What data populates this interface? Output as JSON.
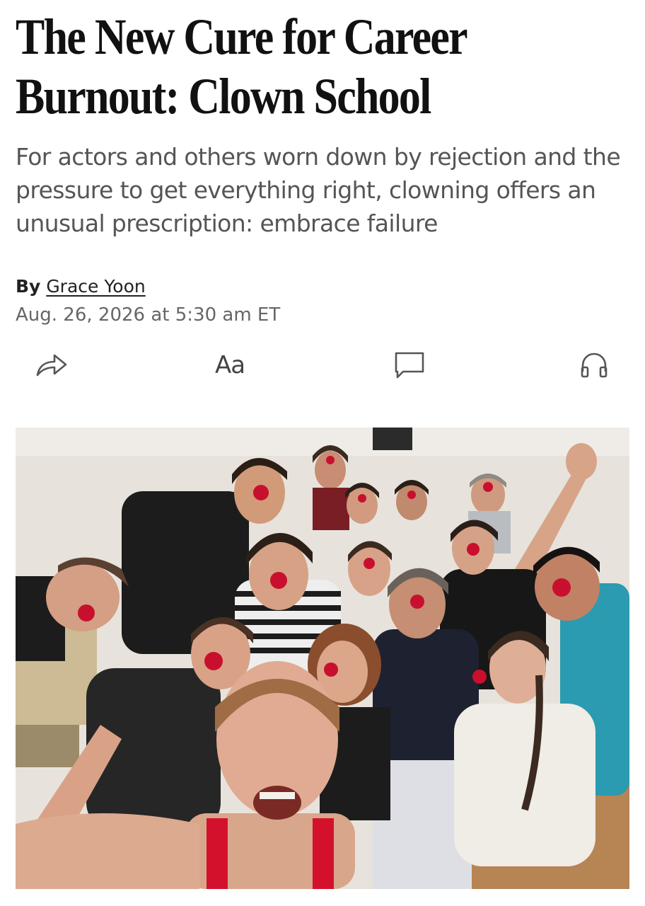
{
  "article": {
    "headline": "The New Cure for Career Burnout: Clown School",
    "dek": "For actors and others worn down by rejection and the pressure to get everything right, clowning offers an unusual prescription: embrace failure",
    "byline_prefix": "By",
    "author": "Grace Yoon",
    "timestamp": "Aug. 26, 2026 at 5:30 am ET"
  },
  "toolbar": {
    "text_size_label": "Aa",
    "icons": [
      "share-icon",
      "text-size-icon",
      "comment-icon",
      "headphones-icon"
    ]
  },
  "hero_image": {
    "caption": "",
    "colors": {
      "wall": "#e7e3dc",
      "floor": "#b78454",
      "red_nose": "#c8102e"
    }
  }
}
